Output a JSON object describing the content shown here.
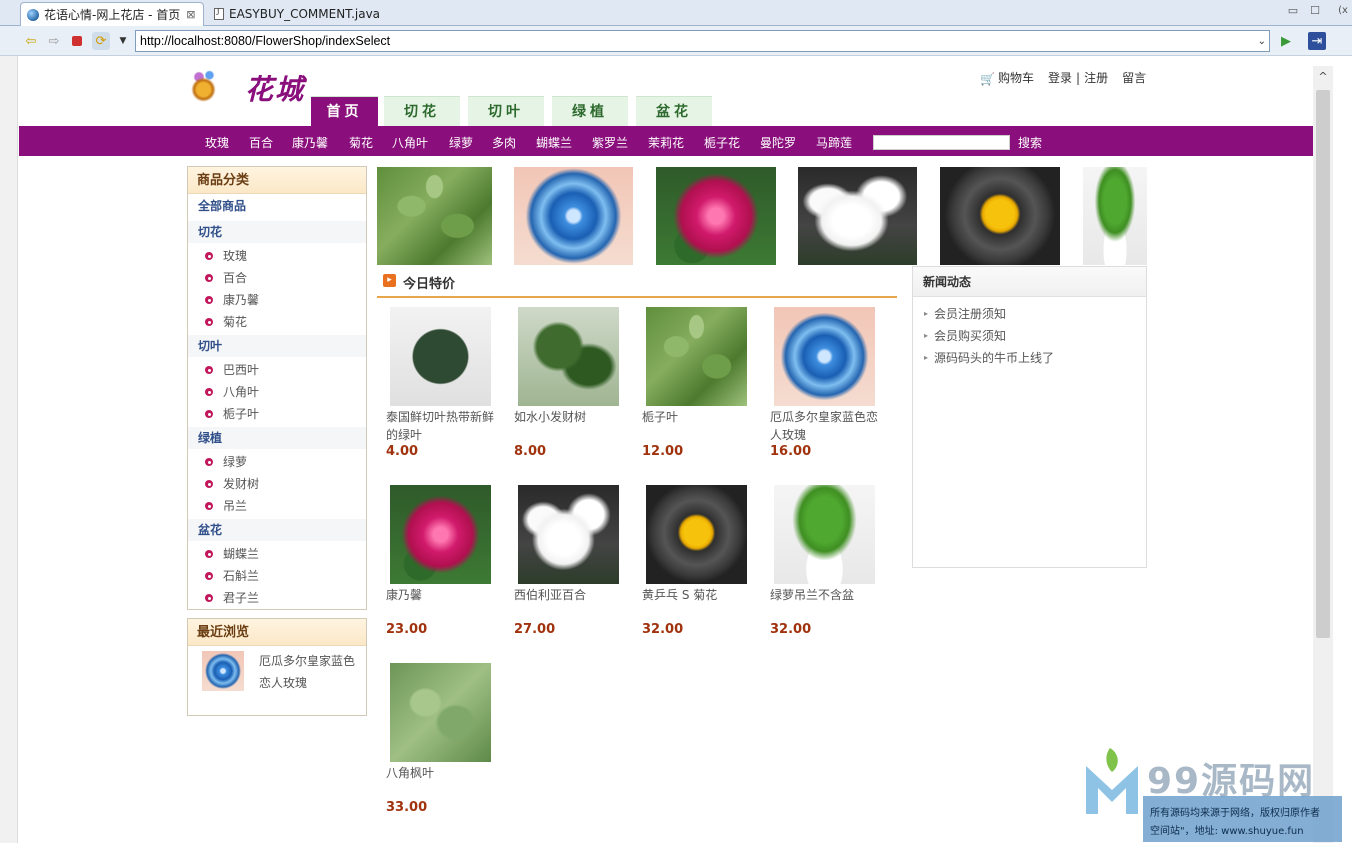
{
  "ide": {
    "tabs": [
      {
        "label": "花语心情-网上花店 - 首页",
        "close": "⊠"
      },
      {
        "label": "EASYBUY_COMMENT.java"
      }
    ],
    "url": "http://localhost:8080/FlowerShop/indexSelect",
    "url_dropdown": "⌄",
    "go_icon": "▶",
    "top_right_label": "(x"
  },
  "site": {
    "logo_text": "花城",
    "top_links": {
      "cart": "购物车",
      "login": "登录",
      "sep": "|",
      "register": "注册",
      "message": "留言"
    },
    "nav_tabs": [
      "首页",
      "切花",
      "切叶",
      "绿植",
      "盆花"
    ],
    "categories_bar": [
      "玫瑰",
      "百合",
      "康乃馨",
      "菊花",
      "八角叶",
      "绿萝",
      "多肉",
      "蝴蝶兰",
      "紫罗兰",
      "茉莉花",
      "栀子花",
      "曼陀罗",
      "马蹄莲"
    ],
    "search_button": "搜索"
  },
  "sidebar": {
    "title": "商品分类",
    "all": "全部商品",
    "groups": [
      {
        "name": "切花",
        "items": [
          "玫瑰",
          "百合",
          "康乃馨",
          "菊花"
        ]
      },
      {
        "name": "切叶",
        "items": [
          "巴西叶",
          "八角叶",
          "栀子叶"
        ]
      },
      {
        "name": "绿植",
        "items": [
          "绿萝",
          "发财树",
          "吊兰"
        ]
      },
      {
        "name": "盆花",
        "items": [
          "蝴蝶兰",
          "石斛兰",
          "君子兰"
        ]
      }
    ],
    "recent_title": "最近浏览",
    "recent_item": [
      "厄瓜多尔皇家蓝色",
      "恋人玫瑰"
    ]
  },
  "special": {
    "title": "今日特价",
    "products": [
      {
        "name": [
          "泰国鲜切叶热带新鲜",
          "的绿叶"
        ],
        "price": "4.00"
      },
      {
        "name": [
          "如水小发财树"
        ],
        "price": "8.00"
      },
      {
        "name": [
          "栀子叶"
        ],
        "price": "12.00"
      },
      {
        "name": [
          "厄瓜多尔皇家蓝色恋",
          "人玫瑰"
        ],
        "price": "16.00"
      },
      {
        "name": [
          "康乃馨"
        ],
        "price": "23.00"
      },
      {
        "name": [
          "西伯利亚百合"
        ],
        "price": "27.00"
      },
      {
        "name": [
          "黄乒乓 S 菊花"
        ],
        "price": "32.00"
      },
      {
        "name": [
          "绿萝吊兰不含盆"
        ],
        "price": "32.00"
      },
      {
        "name": [
          "八角枫叶"
        ],
        "price": "33.00"
      }
    ]
  },
  "news": {
    "title": "新闻动态",
    "items": [
      "会员注册须知",
      "会员购买须知",
      "源码码头的牛币上线了"
    ]
  },
  "watermark": {
    "text": "99源码网",
    "line1": "所有源码均来源于网络，版权归原作者",
    "line2": "空间站\"，地址: www.shuyue.fun"
  }
}
